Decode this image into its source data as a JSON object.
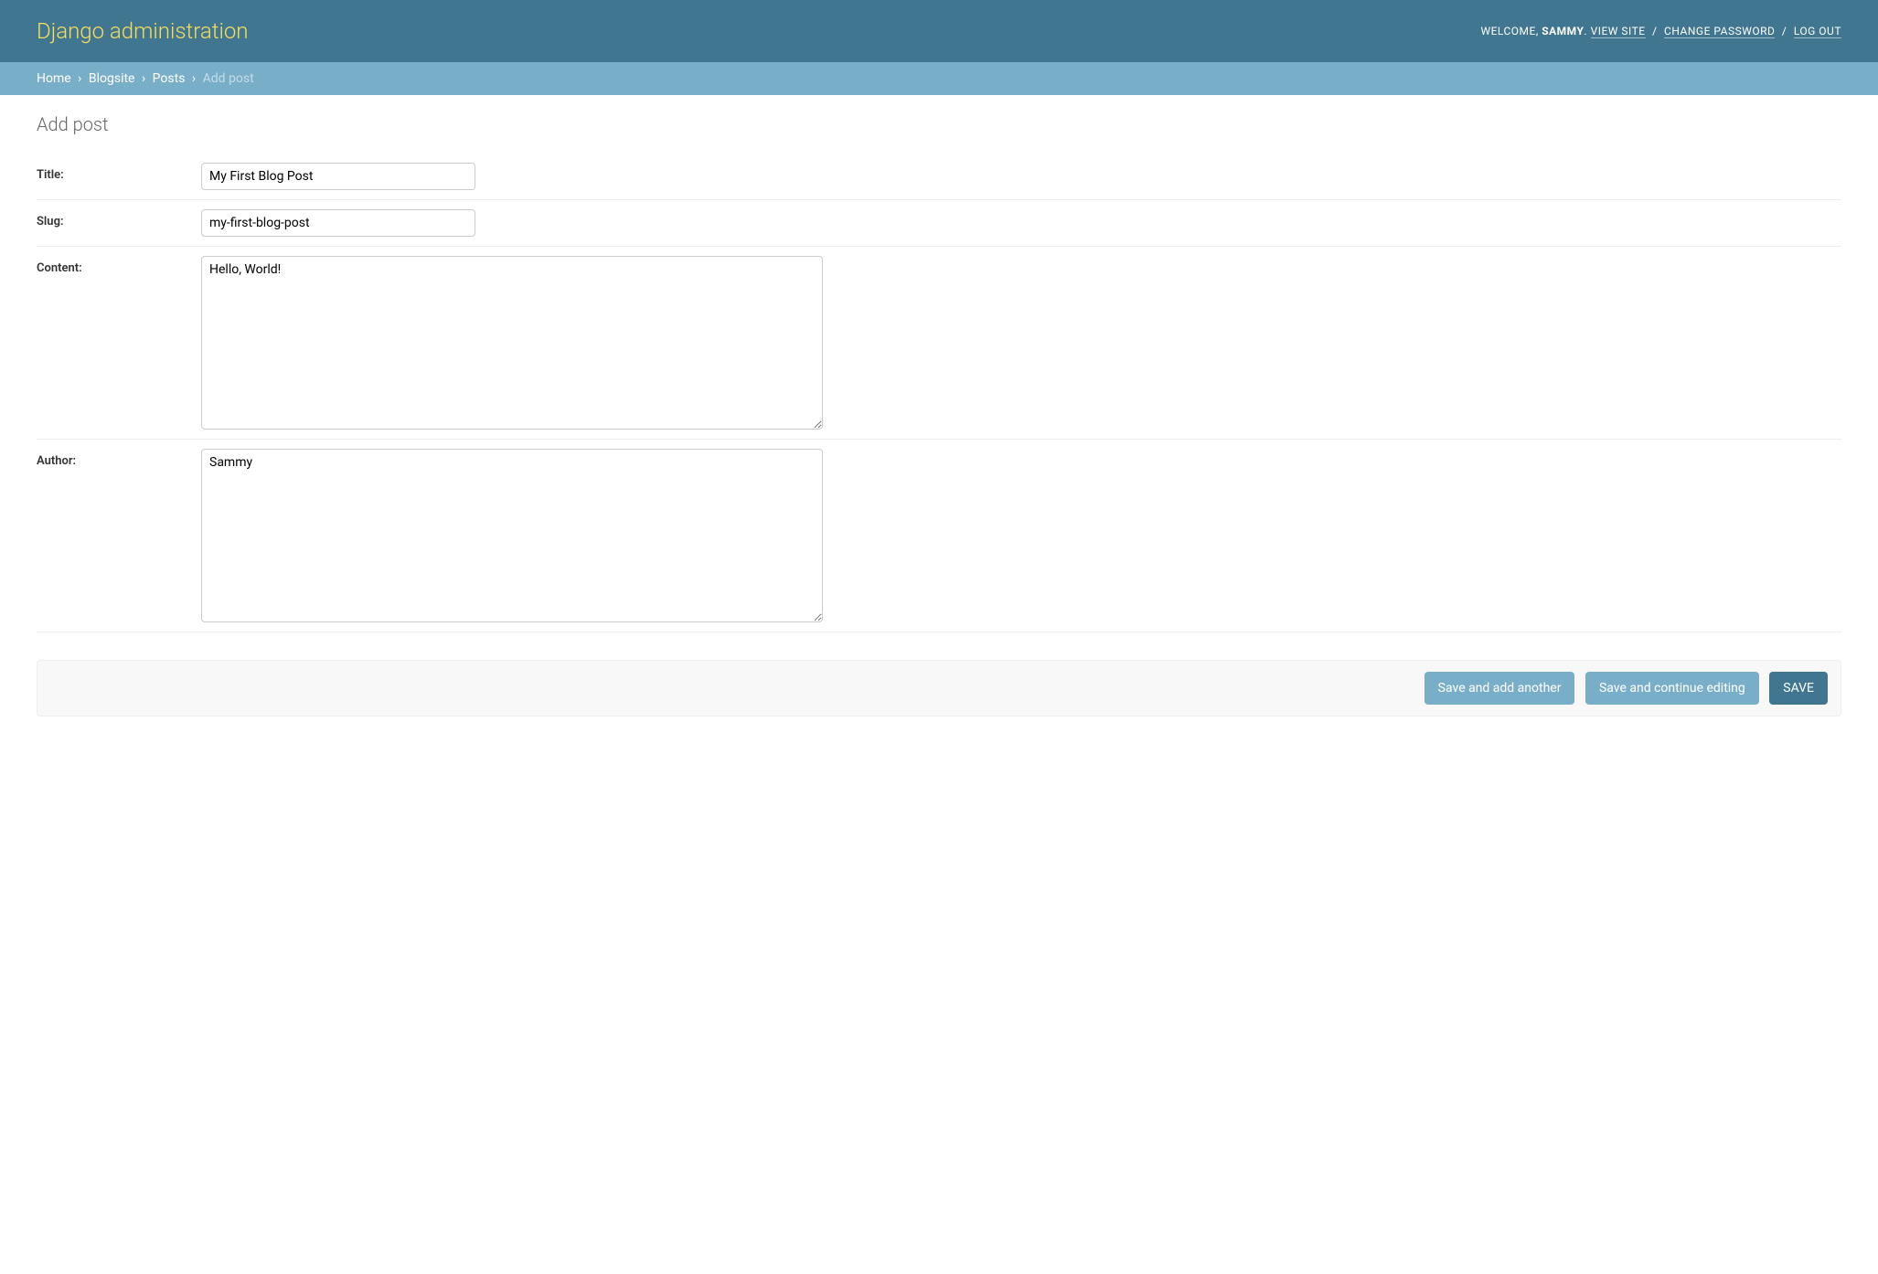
{
  "header": {
    "branding": "Django administration",
    "welcome_prefix": "WELCOME, ",
    "username": "SAMMY",
    "view_site": "VIEW SITE",
    "change_password": "CHANGE PASSWORD",
    "log_out": "LOG OUT"
  },
  "breadcrumbs": {
    "home": "Home",
    "app": "Blogsite",
    "model": "Posts",
    "current": "Add post"
  },
  "page_title": "Add post",
  "fields": {
    "title": {
      "label": "Title:",
      "value": "My First Blog Post"
    },
    "slug": {
      "label": "Slug:",
      "value": "my-first-blog-post"
    },
    "content": {
      "label": "Content:",
      "value": "Hello, World!"
    },
    "author": {
      "label": "Author:",
      "value": "Sammy"
    }
  },
  "buttons": {
    "save_add_another": "Save and add another",
    "save_continue": "Save and continue editing",
    "save": "SAVE"
  }
}
